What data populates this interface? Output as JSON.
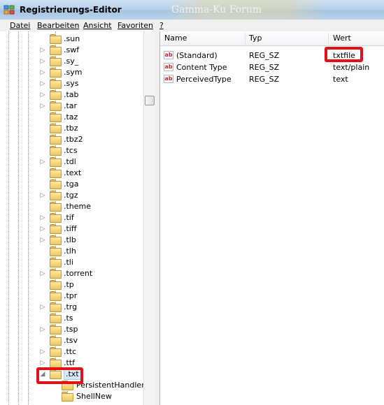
{
  "window": {
    "title": "Registrierungs-Editor",
    "ghost_text": "Gamma-Ku Forum"
  },
  "menu": [
    {
      "label": "Datei"
    },
    {
      "label": "Bearbeiten"
    },
    {
      "label": "Ansicht"
    },
    {
      "label": "Favoriten"
    },
    {
      "label": "?"
    }
  ],
  "tree": {
    "items": [
      {
        "label": ".sun",
        "expander": ""
      },
      {
        "label": ".swf",
        "expander": "▷"
      },
      {
        "label": ".sy_",
        "expander": "▷"
      },
      {
        "label": ".sym",
        "expander": "▷"
      },
      {
        "label": ".sys",
        "expander": "▷"
      },
      {
        "label": ".tab",
        "expander": "▷"
      },
      {
        "label": ".tar",
        "expander": "▷"
      },
      {
        "label": ".taz",
        "expander": ""
      },
      {
        "label": ".tbz",
        "expander": ""
      },
      {
        "label": ".tbz2",
        "expander": ""
      },
      {
        "label": ".tcs",
        "expander": ""
      },
      {
        "label": ".tdl",
        "expander": "▷"
      },
      {
        "label": ".text",
        "expander": ""
      },
      {
        "label": ".tga",
        "expander": ""
      },
      {
        "label": ".tgz",
        "expander": "▷"
      },
      {
        "label": ".theme",
        "expander": ""
      },
      {
        "label": ".tif",
        "expander": "▷"
      },
      {
        "label": ".tiff",
        "expander": "▷"
      },
      {
        "label": ".tlb",
        "expander": "▷"
      },
      {
        "label": ".tlh",
        "expander": ""
      },
      {
        "label": ".tli",
        "expander": ""
      },
      {
        "label": ".torrent",
        "expander": "▷"
      },
      {
        "label": ".tp",
        "expander": ""
      },
      {
        "label": ".tpr",
        "expander": ""
      },
      {
        "label": ".trg",
        "expander": "▷"
      },
      {
        "label": ".ts",
        "expander": ""
      },
      {
        "label": ".tsp",
        "expander": "▷"
      },
      {
        "label": ".tsv",
        "expander": ""
      },
      {
        "label": ".ttc",
        "expander": "▷"
      },
      {
        "label": ".ttf",
        "expander": "▷"
      },
      {
        "label": ".txt",
        "expander": "◢"
      }
    ],
    "children": [
      {
        "label": "PersistentHandler"
      },
      {
        "label": "ShellNew"
      }
    ]
  },
  "list": {
    "columns": {
      "name": "Name",
      "type": "Typ",
      "value": "Wert"
    },
    "rows": [
      {
        "icon": "ab",
        "name": "(Standard)",
        "type": "REG_SZ",
        "value": "txtfile"
      },
      {
        "icon": "ab",
        "name": "Content Type",
        "type": "REG_SZ",
        "value": "text/plain"
      },
      {
        "icon": "ab",
        "name": "PerceivedType",
        "type": "REG_SZ",
        "value": "text"
      }
    ]
  },
  "colors": {
    "highlight": "#e3101a",
    "selection": "#dbeafb"
  }
}
